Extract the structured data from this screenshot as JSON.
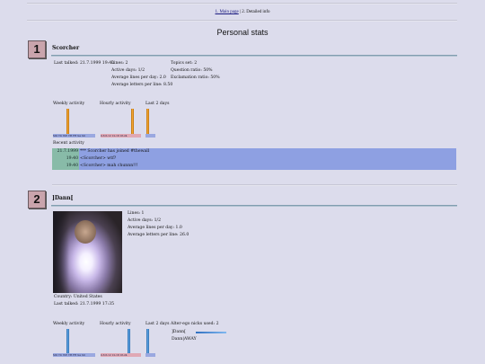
{
  "nav": {
    "main_link": "1. Main page",
    "separator": " | ",
    "current": "2. Detailed info"
  },
  "page_title": "Personal stats",
  "colors": {
    "background": "#dcdcec",
    "rank_badge": "#c9a4ac",
    "activity_time": "#88bba8",
    "activity_msg": "#8ea0e2",
    "bar_user1": "#ffa030",
    "bar_user2": "#4a90d8"
  },
  "users": [
    {
      "rank": "1",
      "name": "Scorcher",
      "last_talked": "Last talked: 21.7.1999 19:40",
      "lines": "Lines: 2",
      "active_days": "Active days: 1/2",
      "avg_lines": "Average lines per day: 2.0",
      "avg_letters": "Average letters per line: 8.50",
      "topics_set": "Topics set: 2",
      "question_ratio": "Question ratio: 50%",
      "exclamation_ratio": "Exclamation ratio: 50%",
      "weekly_label": "Weekly activity",
      "hourly_label": "Hourly activity",
      "last_days_label": "Last 2 days",
      "weekday_axis": "MO TU WE TH FR SA SU",
      "hour_axis": "0-6  6-12 12-18 18-24",
      "weekly_values": [
        0,
        0,
        0,
        0,
        0,
        0,
        0
      ],
      "weekly_bars": [
        {
          "value": 1
        }
      ],
      "hourly_bars": [
        {
          "value": 1
        }
      ],
      "days_bars": [
        {
          "value": 1
        }
      ],
      "recent_label": "Recent activity",
      "recent": [
        {
          "time": "21.7.1999 19:39",
          "msg": "*** Scorcher has joined #thewall"
        },
        {
          "time": "19:40",
          "msg": "<Scorcher> wtf?"
        },
        {
          "time": "19:40",
          "msg": "<Scorcher> mah chunnn!!!"
        }
      ]
    },
    {
      "rank": "2",
      "name": "]Dann[",
      "lines": "Lines: 1",
      "active_days": "Active days: 1/2",
      "avg_lines": "Average lines per day: 1.0",
      "avg_letters": "Average letters per line: 26.0",
      "country": "Country: United States",
      "last_talked": "Last talked: 21.7.1999 17:35",
      "weekly_label": "Weekly activity",
      "hourly_label": "Hourly activity",
      "last_days_label": "Last 2 days",
      "weekday_axis": "MO TU WE TH FR SA SU",
      "hour_axis": "0-6  6-12 12-18 18-24",
      "alter_ego_label": "Alter-ego nicks used: 2",
      "alter_egos": [
        {
          "nick": "]Dann[",
          "share": 1.0
        },
        {
          "nick": "Dann|AWAY",
          "share": 0.0
        }
      ]
    }
  ]
}
